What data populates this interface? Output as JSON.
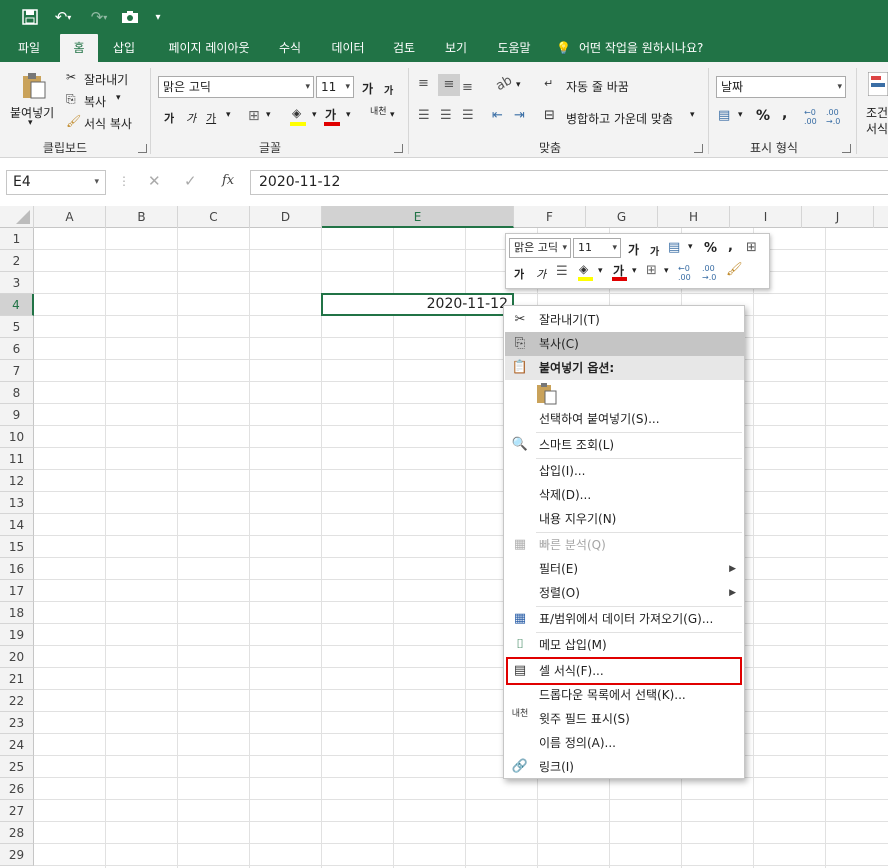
{
  "qat": {
    "save_icon": "save-icon",
    "undo_icon": "undo-icon",
    "redo_icon": "redo-icon",
    "camera_icon": "camera-icon",
    "customize_icon": "customize-icon"
  },
  "tabs": [
    {
      "label": "파일"
    },
    {
      "label": "홈"
    },
    {
      "label": "삽입"
    },
    {
      "label": "페이지 레이아웃"
    },
    {
      "label": "수식"
    },
    {
      "label": "데이터"
    },
    {
      "label": "검토"
    },
    {
      "label": "보기"
    },
    {
      "label": "도움말"
    }
  ],
  "tell_me": "어떤 작업을 원하시나요?",
  "clipboard": {
    "paste": "붙여넣기",
    "cut": "잘라내기",
    "copy": "복사",
    "format_painter": "서식 복사",
    "group": "클립보드"
  },
  "font": {
    "name": "맑은 고딕",
    "size": "11",
    "grow": "가",
    "shrink": "가",
    "bold": "가",
    "italic": "가",
    "underline": "가",
    "color_a": "가",
    "phonetic": "내천",
    "group": "글꼴"
  },
  "alignment": {
    "wrap": "자동 줄 바꿈",
    "merge": "병합하고 가운데 맞춤",
    "group": "맞춤"
  },
  "number": {
    "format": "날짜",
    "percent": "%",
    "comma": ",",
    "group": "표시 형식"
  },
  "styles": {
    "cond1": "조건",
    "cond2": "서식"
  },
  "formula_bar": {
    "name_box": "E4",
    "fx": "fx",
    "value": "2020-11-12"
  },
  "columns": [
    "A",
    "B",
    "C",
    "D",
    "E",
    "F",
    "G",
    "H",
    "I",
    "J"
  ],
  "rows": [
    "1",
    "2",
    "3",
    "4",
    "5",
    "6",
    "7",
    "8",
    "9",
    "10",
    "11",
    "12",
    "13",
    "14",
    "15",
    "16",
    "17",
    "18",
    "19",
    "20",
    "21",
    "22",
    "23",
    "24",
    "25",
    "26",
    "27",
    "28",
    "29"
  ],
  "selected_cell_value": "2020-11-12",
  "mini_toolbar": {
    "font": "맑은 고딕",
    "size": "11",
    "grow": "가",
    "shrink": "가",
    "percent": "%",
    "comma": ",",
    "bold": "가",
    "italic": "가",
    "color_a": "가"
  },
  "context_menu": {
    "cut": "잘라내기(T)",
    "copy": "복사(C)",
    "paste_options": "붙여넣기 옵션:",
    "paste_special": "선택하여 붙여넣기(S)...",
    "smart_lookup": "스마트 조회(L)",
    "insert": "삽입(I)...",
    "delete": "삭제(D)...",
    "clear": "내용 지우기(N)",
    "quick_analysis": "빠른 분석(Q)",
    "filter": "필터(E)",
    "sort": "정렬(O)",
    "get_data": "표/범위에서 데이터 가져오기(G)...",
    "insert_comment": "메모 삽입(M)",
    "format_cells": "셀 서식(F)...",
    "dropdown": "드롭다운 목록에서 선택(K)...",
    "phonetic": "윗주 필드 표시(S)",
    "define_name": "이름 정의(A)...",
    "link": "링크(I)"
  },
  "colors": {
    "excel_green": "#217346",
    "highlight_box": "#e00000"
  }
}
